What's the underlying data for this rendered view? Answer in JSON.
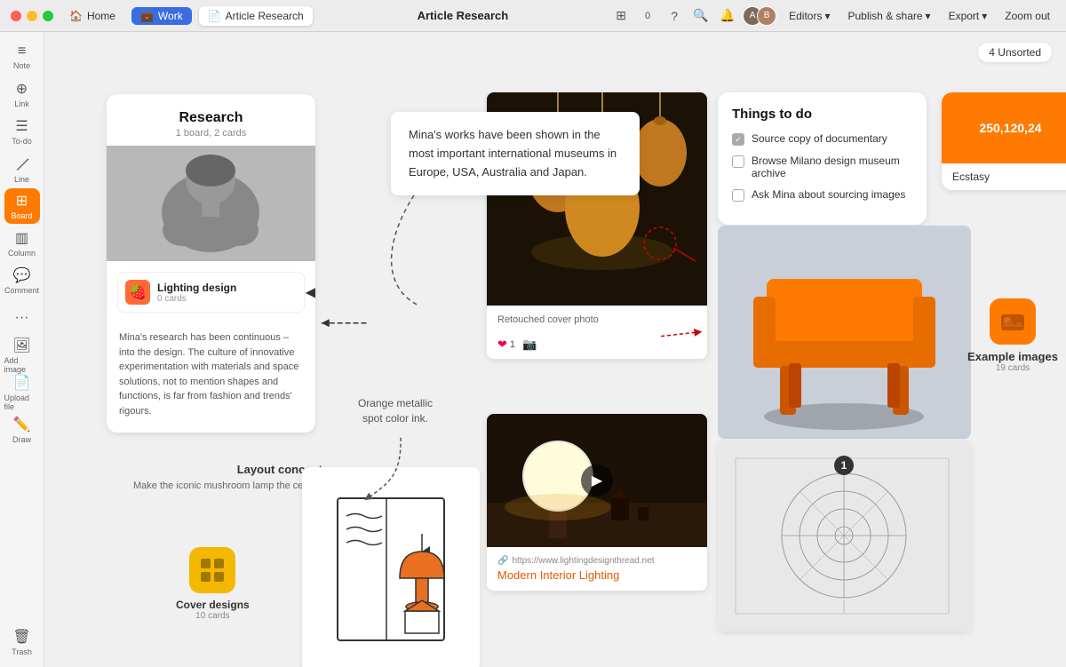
{
  "titlebar": {
    "title": "Article Research",
    "tabs": [
      {
        "label": "Home",
        "icon": "home",
        "active": false
      },
      {
        "label": "Work",
        "icon": "work",
        "active": false
      },
      {
        "label": "Article Research",
        "icon": "doc",
        "active": true
      }
    ],
    "editors_label": "Editors",
    "publish_label": "Publish & share",
    "export_label": "Export",
    "zoom_label": "Zoom out"
  },
  "sidebar": {
    "items": [
      {
        "label": "Note",
        "icon": "≡",
        "active": false
      },
      {
        "label": "Link",
        "icon": "🔗",
        "active": false
      },
      {
        "label": "To-do",
        "icon": "☰",
        "active": false
      },
      {
        "label": "Line",
        "icon": "╱",
        "active": false
      },
      {
        "label": "Board",
        "icon": "⊞",
        "active": true
      },
      {
        "label": "Column",
        "icon": "▥",
        "active": false
      },
      {
        "label": "Comment",
        "icon": "💬",
        "active": false
      },
      {
        "label": "···",
        "icon": "···",
        "active": false
      },
      {
        "label": "Add image",
        "icon": "🖼",
        "active": false
      },
      {
        "label": "Upload file",
        "icon": "📄",
        "active": false
      },
      {
        "label": "Draw",
        "icon": "✏️",
        "active": false
      },
      {
        "label": "Trash",
        "icon": "🗑",
        "active": false
      }
    ]
  },
  "unsorted": {
    "label": "4 Unsorted"
  },
  "research_card": {
    "title": "Research",
    "subtitle": "1 board, 2 cards",
    "nested_title": "Lighting design",
    "nested_sub": "0 cards",
    "body_text": "Mina's research has been continuous – into the design. The culture of innovative experimentation with materials and space solutions, not to mention shapes and functions, is far from fashion and trends' rigours."
  },
  "text_bubble": {
    "text": "Mina's works have been shown in the most important international museums in Europe, USA, Australia and Japan."
  },
  "orange_label": {
    "text": "Orange metallic spot color ink."
  },
  "layout_concept": {
    "title": "Layout concept",
    "desc": "Make the iconic mushroom lamp the central focus to the book cover"
  },
  "cover_designs": {
    "title": "Cover designs",
    "sub": "10 cards"
  },
  "photo_top": {
    "caption": "Retouched cover photo"
  },
  "photo_bottom": {
    "url": "https://www.lightingdesignthread.net",
    "link_title": "Modern Interior Lighting"
  },
  "todo": {
    "title": "Things to do",
    "items": [
      {
        "text": "Source copy of documentary",
        "checked": true
      },
      {
        "text": "Browse Milano design museum archive",
        "checked": false
      },
      {
        "text": "Ask Mina about sourcing images",
        "checked": false
      }
    ]
  },
  "color_card": {
    "value": "250,120,24",
    "name": "Ecstasy"
  },
  "example_images": {
    "title": "Example images",
    "sub": "19 cards"
  },
  "reactions": {
    "heart_count": "1"
  }
}
